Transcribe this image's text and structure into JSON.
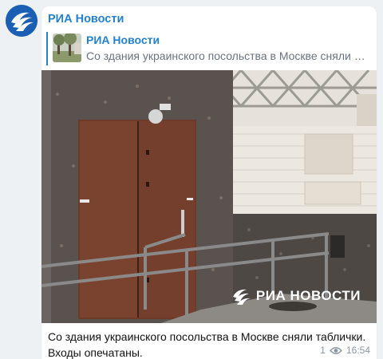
{
  "channel": {
    "name": "РИА Новости"
  },
  "reply": {
    "title": "РИА Новости",
    "snippet": "Со здания украинского посольства в Москве сняли ф..."
  },
  "photo": {
    "watermark": "РИА НОВОСТИ",
    "icon": "embassy-door-photo"
  },
  "message": {
    "text": "Со здания украинского посольства в Москве сняли таблички. Входы опечатаны.",
    "views": "1",
    "time": "16:54"
  },
  "colors": {
    "accent": "#2481cc",
    "background": "#eef1f4",
    "bubble": "#ffffff",
    "meta": "#8a97a3"
  }
}
